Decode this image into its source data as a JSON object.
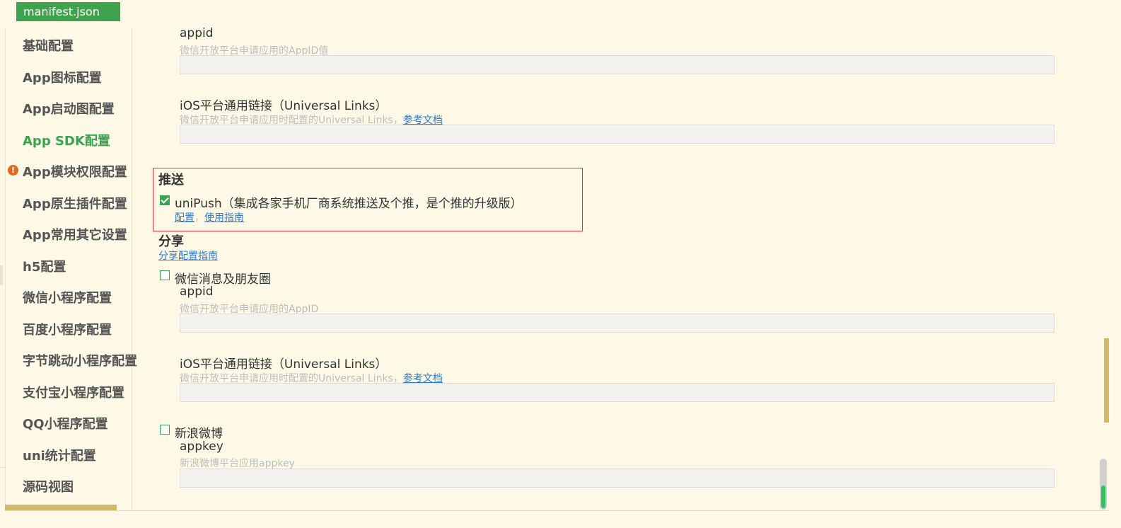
{
  "tab": {
    "filename": "manifest.json"
  },
  "sidebar": {
    "items": [
      {
        "label": "基础配置"
      },
      {
        "label": "App图标配置"
      },
      {
        "label": "App启动图配置"
      },
      {
        "label": "App SDK配置"
      },
      {
        "label": "App模块权限配置"
      },
      {
        "label": "App原生插件配置"
      },
      {
        "label": "App常用其它设置"
      },
      {
        "label": "h5配置"
      },
      {
        "label": "微信小程序配置"
      },
      {
        "label": "百度小程序配置"
      },
      {
        "label": "字节跳动小程序配置"
      },
      {
        "label": "支付宝小程序配置"
      },
      {
        "label": "QQ小程序配置"
      },
      {
        "label": "uni统计配置"
      },
      {
        "label": "源码视图"
      }
    ],
    "warning_glyph": "!"
  },
  "login": {
    "appid_label": "appid",
    "appid_hint": "微信开放平台申请应用的AppID值",
    "appid_value": "",
    "ul_label": "iOS平台通用链接（Universal Links）",
    "ul_hint": "微信开放平台申请应用时配置的Universal Links，",
    "ul_link": "参考文档",
    "ul_value": ""
  },
  "push": {
    "title": "推送",
    "unipush_label": "uniPush（集成各家手机厂商系统推送及个推，是个推的升级版）",
    "unipush_checked": true,
    "config_link": "配置",
    "sep": "，",
    "guide_link": "使用指南"
  },
  "share": {
    "title": "分享",
    "guide_link": "分享配置指南",
    "weixin": {
      "label": "微信消息及朋友圈",
      "checked": false,
      "appid_label": "appid",
      "appid_hint": "微信开放平台申请应用的AppID",
      "appid_value": "",
      "ul_label": "iOS平台通用链接（Universal Links）",
      "ul_hint": "微信开放平台申请应用时配置的Universal Links，",
      "ul_link": "参考文档",
      "ul_value": ""
    },
    "sina": {
      "label": "新浪微博",
      "checked": false,
      "appkey_label": "appkey",
      "appkey_hint": "新浪微博平台应用appkey",
      "appkey_value": ""
    }
  },
  "colors": {
    "accent": "#3aa34f",
    "background": "#fef9e7",
    "warning": "#e36a1e",
    "highlight_border": "#e0303a",
    "link": "#2b7bd4"
  }
}
